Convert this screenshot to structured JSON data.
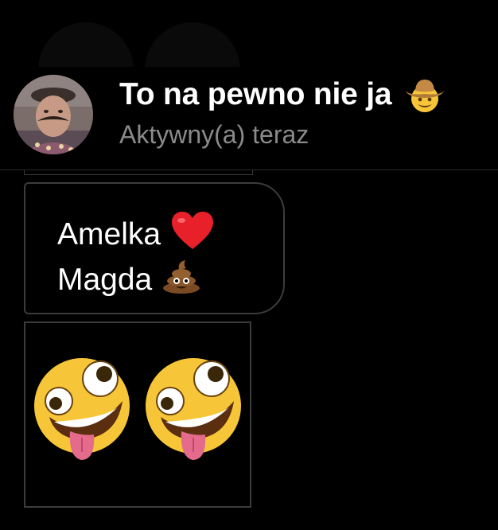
{
  "header": {
    "title": "To na pewno nie ja",
    "title_emoji": "cowboy-hat-face",
    "status": "Aktywny(a) teraz"
  },
  "messages": [
    {
      "type": "text",
      "lines": [
        {
          "text": "Amelka",
          "emoji": "red-heart"
        },
        {
          "text": "Magda",
          "emoji": "pile-of-poo"
        }
      ]
    },
    {
      "type": "emoji",
      "emojis": [
        "zany-face",
        "zany-face"
      ]
    }
  ],
  "colors": {
    "background": "#000000",
    "status_text": "#8a8a8a",
    "bubble_border": "#3c3c3c"
  }
}
